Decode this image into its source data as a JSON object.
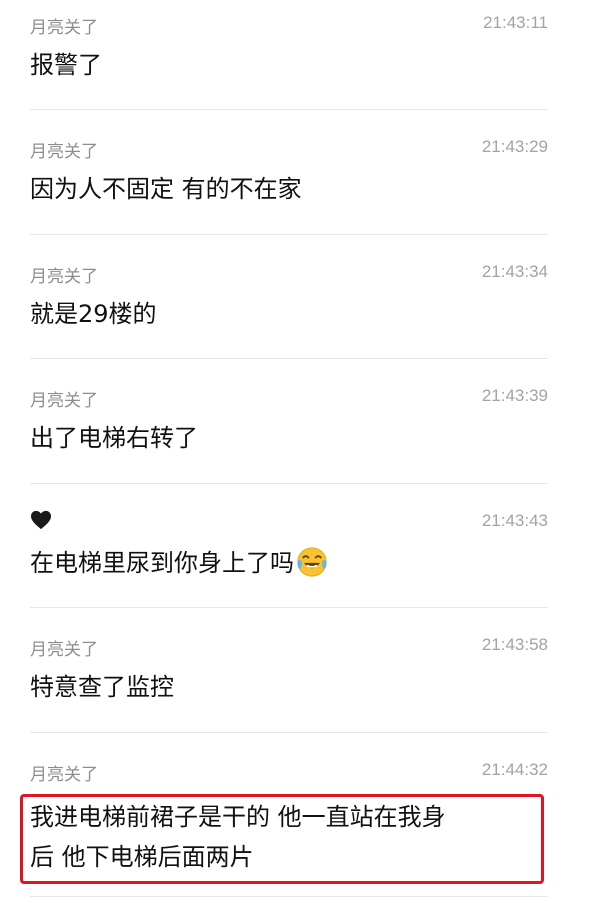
{
  "messages": [
    {
      "sender": "月亮关了",
      "time": "21:43:11",
      "text": "报警了"
    },
    {
      "sender": "月亮关了",
      "time": "21:43:29",
      "text": "因为人不固定 有的不在家"
    },
    {
      "sender": "月亮关了",
      "time": "21:43:34",
      "text": "就是29楼的"
    },
    {
      "sender": "月亮关了",
      "time": "21:43:39",
      "text": "出了电梯右转了"
    },
    {
      "sender_icon": "black-heart-icon",
      "time": "21:43:43",
      "text": "在电梯里尿到你身上了吗",
      "trailing_emoji": "laughing-crying-emoji-icon"
    },
    {
      "sender": "月亮关了",
      "time": "21:43:58",
      "text": "特意查了监控"
    },
    {
      "sender": "月亮关了",
      "time": "21:44:32",
      "text_line1": "我进电梯前裙子是干的 他一直站在我身",
      "text_line2": "后 他下电梯后面两片"
    }
  ],
  "colors": {
    "highlight_border": "#e0151f",
    "sender_text": "#8d8d8d",
    "time_text": "#a3a3a3",
    "divider": "#e6e6e6"
  }
}
